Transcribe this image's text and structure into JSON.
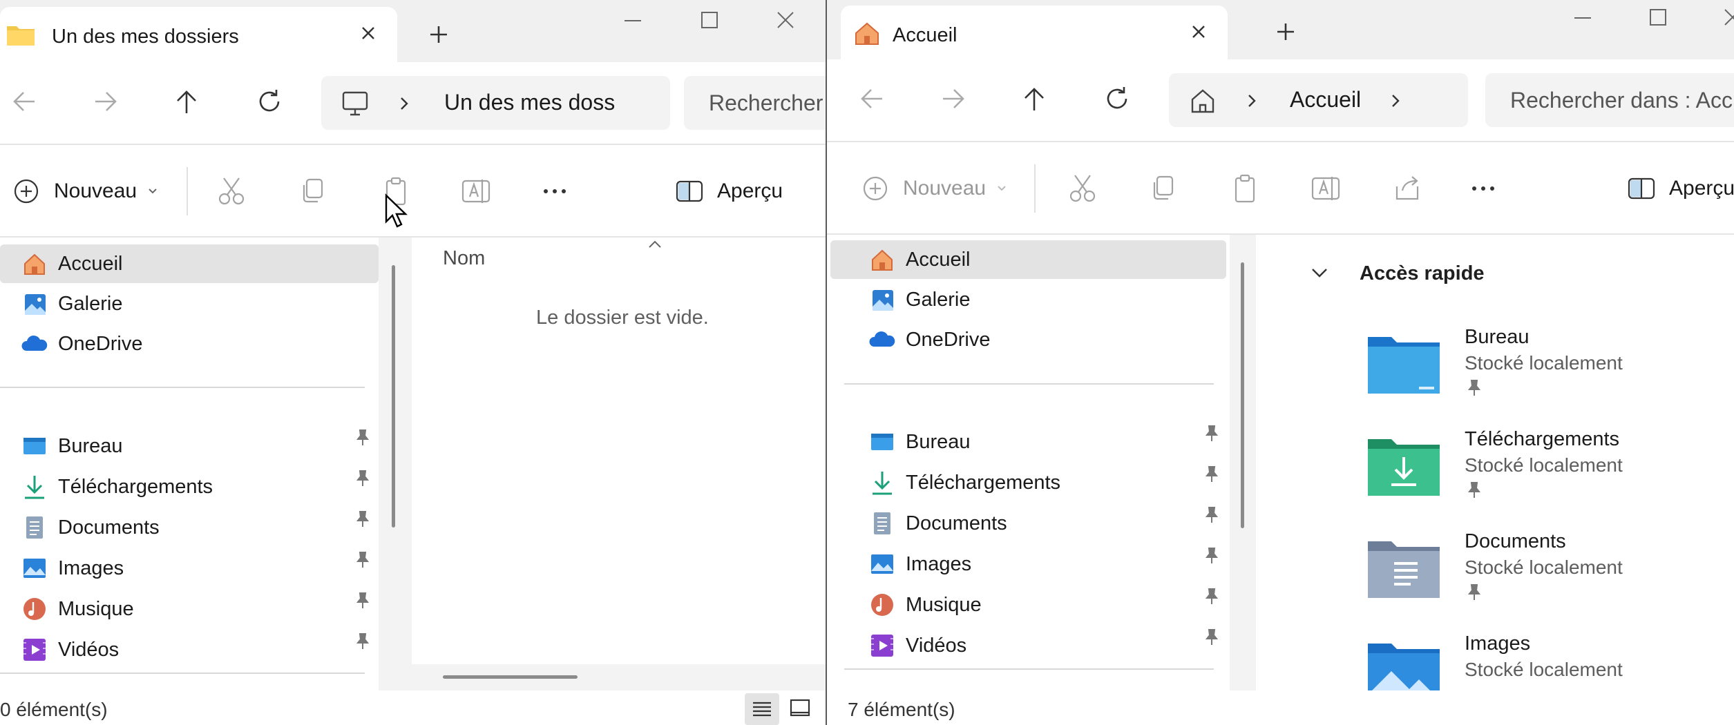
{
  "left_window": {
    "tab_title": "Un des mes dossiers",
    "address_text": "Un des mes doss",
    "search_placeholder": "Rechercher",
    "toolbar": {
      "new_label": "Nouveau",
      "preview_label": "Aperçu"
    },
    "nav": {
      "top_items": [
        {
          "label": "Accueil",
          "icon": "home-icon"
        },
        {
          "label": "Galerie",
          "icon": "gallery-icon"
        },
        {
          "label": "OneDrive",
          "icon": "onedrive-icon"
        }
      ],
      "pinned_items": [
        {
          "label": "Bureau",
          "icon": "desktop-icon"
        },
        {
          "label": "Téléchargements",
          "icon": "downloads-icon"
        },
        {
          "label": "Documents",
          "icon": "documents-icon"
        },
        {
          "label": "Images",
          "icon": "pictures-icon"
        },
        {
          "label": "Musique",
          "icon": "music-icon"
        },
        {
          "label": "Vidéos",
          "icon": "videos-icon"
        }
      ]
    },
    "content": {
      "column_name": "Nom",
      "empty_message": "Le dossier est vide."
    },
    "status_text": "0 élément(s)"
  },
  "right_window": {
    "tab_title": "Accueil",
    "address_text": "Accueil",
    "search_placeholder": "Rechercher dans : Acc",
    "toolbar": {
      "new_label": "Nouveau",
      "preview_label": "Aperçu"
    },
    "nav": {
      "top_items": [
        {
          "label": "Accueil",
          "icon": "home-icon"
        },
        {
          "label": "Galerie",
          "icon": "gallery-icon"
        },
        {
          "label": "OneDrive",
          "icon": "onedrive-icon"
        }
      ],
      "pinned_items": [
        {
          "label": "Bureau",
          "icon": "desktop-icon"
        },
        {
          "label": "Téléchargements",
          "icon": "downloads-icon"
        },
        {
          "label": "Documents",
          "icon": "documents-icon"
        },
        {
          "label": "Images",
          "icon": "pictures-icon"
        },
        {
          "label": "Musique",
          "icon": "music-icon"
        },
        {
          "label": "Vidéos",
          "icon": "videos-icon"
        }
      ]
    },
    "quick_access": {
      "header": "Accès rapide",
      "items": [
        {
          "name": "Bureau",
          "sub": "Stocké localement"
        },
        {
          "name": "Téléchargements",
          "sub": "Stocké localement"
        },
        {
          "name": "Documents",
          "sub": "Stocké localement"
        },
        {
          "name": "Images",
          "sub": "Stocké localement"
        }
      ]
    },
    "status_text": "7 élément(s)"
  },
  "colors": {
    "accent": "#0067c0",
    "selected": "#e3e3e3",
    "titlebar": "#f0f0f0"
  }
}
